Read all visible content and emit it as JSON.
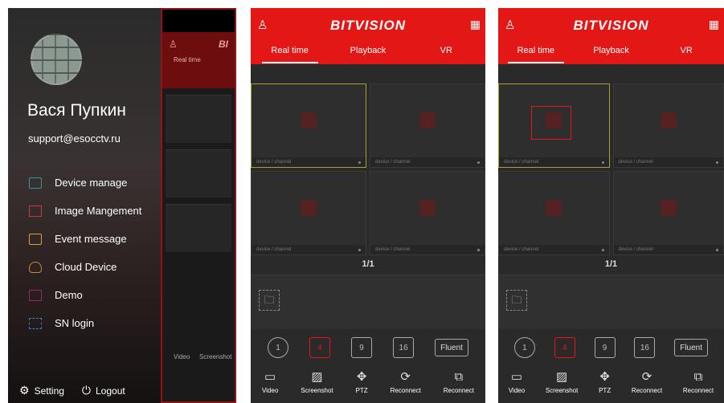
{
  "drawer": {
    "user_name": "Вася Пупкин",
    "email": "support@esocctv.ru",
    "menu": [
      {
        "label": "Device manage",
        "icon": "device-icon"
      },
      {
        "label": "Image Mangement",
        "icon": "image-icon"
      },
      {
        "label": "Event message",
        "icon": "event-icon"
      },
      {
        "label": "Cloud Device",
        "icon": "cloud-icon"
      },
      {
        "label": "Demo",
        "icon": "demo-icon"
      },
      {
        "label": "SN login",
        "icon": "sn-icon"
      }
    ],
    "setting_label": "Setting",
    "logout_label": "Logout",
    "peek_brand": "BI",
    "peek_tab": "Real time",
    "peek_tools": [
      "Video",
      "Screenshot"
    ]
  },
  "live": {
    "brand": "BITVISION",
    "tabs": [
      "Real time",
      "Playback",
      "VR"
    ],
    "channel_caption": "device / channel",
    "page": "1/1",
    "modes": [
      "1",
      "4",
      "9",
      "16"
    ],
    "quality": "Fluent",
    "tools": [
      "Video",
      "Screenshot",
      "PTZ",
      "Reconnect",
      "Reconnect"
    ]
  },
  "colors": {
    "accent": "#e41717",
    "selected_border": "#a8a32a"
  }
}
